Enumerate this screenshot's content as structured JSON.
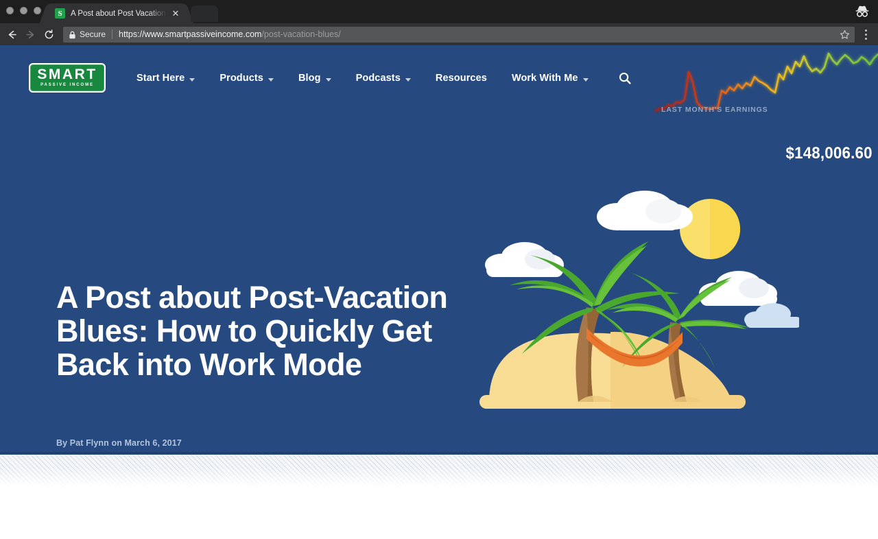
{
  "browser": {
    "window_controls": [
      "close",
      "minimize",
      "maximize"
    ],
    "tab": {
      "title": "A Post about Post Vacation Blu",
      "favicon_letter": "S",
      "favicon_color": "#21a14b",
      "close_label": "✕"
    },
    "incognito_icon": "incognito-icon",
    "back_label": "←",
    "forward_label": "→",
    "reload_label": "⟳",
    "omnibox": {
      "security_label": "Secure",
      "url_domain": "https://www.smartpassiveincome.com",
      "url_path": "/post-vacation-blues/",
      "lock_icon": "lock-icon",
      "star_icon": "star-icon"
    },
    "menu_icon": "kebab-menu-icon"
  },
  "site": {
    "logo": {
      "main": "SMART",
      "sub": "PASSIVE INCOME",
      "bg_color": "#18883f"
    },
    "nav": [
      {
        "label": "Start Here",
        "has_dropdown": true
      },
      {
        "label": "Products",
        "has_dropdown": true
      },
      {
        "label": "Blog",
        "has_dropdown": true
      },
      {
        "label": "Podcasts",
        "has_dropdown": true
      },
      {
        "label": "Resources",
        "has_dropdown": false
      },
      {
        "label": "Work With Me",
        "has_dropdown": true
      }
    ],
    "search_icon": "search-icon",
    "earnings": {
      "label": "LAST MONTH'S EARNINGS",
      "amount": "$148,006.60",
      "chart_low_color": "#b02a22",
      "chart_mid_color": "#f2a81d",
      "chart_high_color": "#79c143"
    }
  },
  "hero": {
    "bg_color": "#264a80",
    "title": "A Post about Post-Vacation Blues: How to Quickly Get Back into Work Mode",
    "byline": "By Pat Flynn on March 6, 2017",
    "illustration": {
      "name": "beach-island-illustration",
      "elements": [
        "sun",
        "clouds",
        "palm-tree-left",
        "palm-tree-right",
        "hammock",
        "sand-island"
      ],
      "sun_color": "#fada5c",
      "sand_color": "#f7d78a",
      "hammock_color": "#e8762c",
      "palm_green": "#4fb032",
      "trunk_color": "#a0713f"
    }
  },
  "chart_data": {
    "type": "line",
    "title": "LAST MONTH'S EARNINGS",
    "xlabel": "",
    "ylabel": "",
    "grid": false,
    "legend": "none",
    "annotations": [
      "$148,006.60"
    ],
    "x": [
      0,
      1,
      2,
      3,
      4,
      5,
      6,
      7,
      8,
      9,
      10,
      11,
      12,
      13,
      14,
      15,
      16,
      17,
      18,
      19,
      20,
      21,
      22,
      23,
      24,
      25,
      26,
      27,
      28,
      29,
      30,
      31,
      32,
      33,
      34,
      35,
      36,
      37,
      38,
      39,
      40,
      41,
      42,
      43,
      44,
      45,
      46,
      47,
      48,
      49,
      50,
      51,
      52,
      53,
      54,
      55
    ],
    "series": [
      {
        "name": "earnings",
        "values": [
          10,
          14,
          13,
          19,
          17,
          22,
          21,
          26,
          62,
          47,
          21,
          14,
          12,
          11,
          13,
          12,
          38,
          34,
          42,
          37,
          46,
          40,
          48,
          44,
          56,
          50,
          47,
          44,
          38,
          34,
          60,
          52,
          72,
          62,
          80,
          72,
          90,
          74,
          66,
          70,
          64,
          72,
          94,
          82,
          76,
          84,
          92,
          86,
          78,
          80,
          88,
          84,
          76,
          86,
          92,
          88
        ]
      }
    ],
    "color_gradient": [
      "#a32019",
      "#d94a20",
      "#f2a81d",
      "#d6cf2a",
      "#8fc83c",
      "#79c143"
    ]
  }
}
